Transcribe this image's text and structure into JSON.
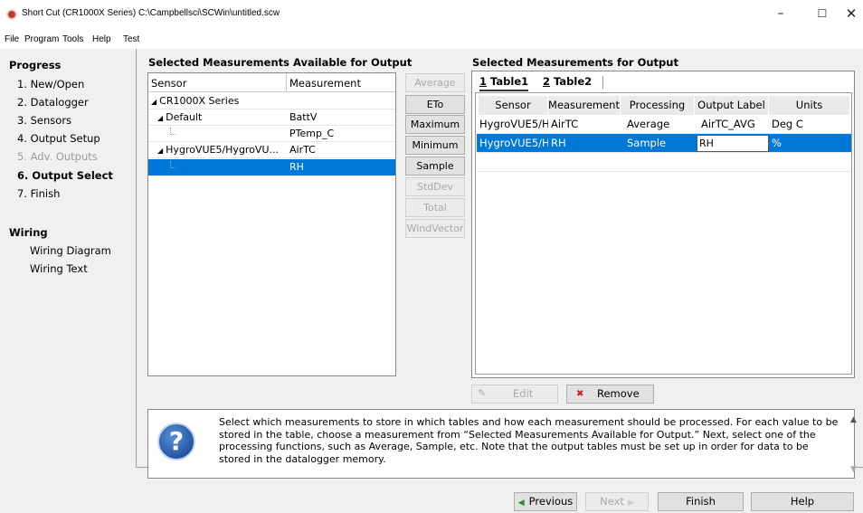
{
  "window": {
    "title": "Short Cut (CR1000X Series) C:\\Campbellsci\\SCWin\\untitled.scw",
    "minimize": "–",
    "maximize": "☐",
    "close": "✕"
  },
  "menu": [
    "File",
    "Program",
    "Tools",
    "Help",
    "Test"
  ],
  "progress": {
    "title": "Progress",
    "steps": [
      "1. New/Open",
      "2. Datalogger",
      "3. Sensors",
      "4. Output Setup",
      "5. Adv. Outputs",
      "6. Output Select",
      "7. Finish"
    ],
    "active_step": "6. Output Select",
    "disabled_step": "5. Adv. Outputs"
  },
  "wiring": {
    "title": "Wiring",
    "items": [
      "Wiring Diagram",
      "Wiring Text"
    ]
  },
  "available": {
    "title": "Selected Measurements Available for Output",
    "col_sensor": "Sensor",
    "col_measurement": "Measurement",
    "rows": [
      {
        "sensor": "CR1000X Series",
        "measurement": ""
      },
      {
        "sensor": "Default",
        "measurement": "BattV"
      },
      {
        "sensor": "",
        "measurement": "PTemp_C"
      },
      {
        "sensor": "HygroVUE5/HygroVU...",
        "measurement": "AirTC"
      },
      {
        "sensor": "",
        "measurement": "RH"
      }
    ]
  },
  "processing_buttons": [
    "Average",
    "ETo",
    "Maximum",
    "Minimum",
    "Sample",
    "StdDev",
    "Total",
    "WindVector"
  ],
  "output": {
    "title": "Selected Measurements for Output",
    "tabs": [
      {
        "num": "1",
        "name": "Table1"
      },
      {
        "num": "2",
        "name": "Table2"
      }
    ],
    "columns": [
      "Sensor",
      "Measurement",
      "Processing",
      "Output Label",
      "Units"
    ],
    "rows": [
      {
        "sensor": "HygroVUE5/H",
        "measurement": "AirTC",
        "processing": "Average",
        "label": "AirTC_AVG",
        "units": "Deg C"
      },
      {
        "sensor": "HygroVUE5/H",
        "measurement": "RH",
        "processing": "Sample",
        "label": "RH",
        "units": "%"
      }
    ],
    "edit_label": "Edit",
    "remove_label": "Remove"
  },
  "help": {
    "icon": "?",
    "text": "Select which measurements to store in which tables and how each measurement should be processed. For each value to be stored in the table, choose a measurement from “Selected Measurements Available for Output.” Next, select one of the processing functions, such as Average, Sample, etc. Note that the output tables must be set up in order for data to be stored in the datalogger memory."
  },
  "nav": {
    "previous": "Previous",
    "next": "Next",
    "finish": "Finish",
    "help": "Help"
  }
}
